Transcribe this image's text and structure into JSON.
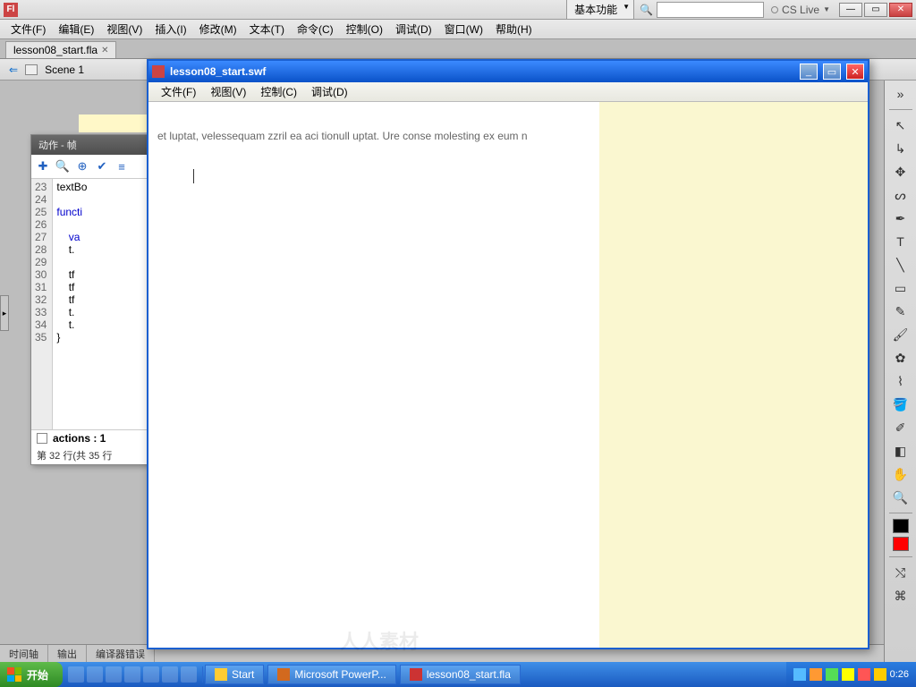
{
  "app": {
    "icon_label": "Fl"
  },
  "workspace": {
    "label": "基本功能"
  },
  "cslive": {
    "label": "CS Live"
  },
  "menu": [
    "文件(F)",
    "编辑(E)",
    "视图(V)",
    "插入(I)",
    "修改(M)",
    "文本(T)",
    "命令(C)",
    "控制(O)",
    "调试(D)",
    "窗口(W)",
    "帮助(H)"
  ],
  "doc_tab": {
    "label": "lesson08_start.fla",
    "close": "✕"
  },
  "scene": {
    "label": "Scene 1",
    "back": "⇐"
  },
  "actions": {
    "title": "动作 - 帧",
    "tools": [
      "✚",
      "🔍",
      "⊕",
      "✔",
      "≡"
    ],
    "lines": {
      "23": "textBo",
      "24": "",
      "25": "functi",
      "26": "",
      "27": "    va",
      "28": "    t.",
      "29": "",
      "30": "    tf",
      "31": "    tf",
      "32": "    tf",
      "33": "    t.",
      "34": "    t.",
      "35": "}"
    },
    "status": "actions : 1",
    "footer": "第 32 行(共 35 行"
  },
  "bottom_tabs": [
    "时间轴",
    "输出",
    "编译器错误"
  ],
  "swf": {
    "title": "lesson08_start.swf",
    "menu": [
      "文件(F)",
      "视图(V)",
      "控制(C)",
      "调试(D)"
    ],
    "body_text": "et luptat, velessequam zzril ea aci tionull uptat. Ure conse molesting ex eum n"
  },
  "tools": {
    "arrow": "↖",
    "subsel": "↳",
    "freet": "✥",
    "lasso": "ᔕ",
    "pen": "✒",
    "text": "T",
    "line": "╲",
    "rect": "▭",
    "pencil": "✎",
    "brush": "🖌",
    "deco": "✿",
    "bone": "⌇",
    "bucket": "🪣",
    "dropper": "✐",
    "eraser": "◧",
    "hand": "✋",
    "zoom": "🔍"
  },
  "taskbar": {
    "start": "开始",
    "tasks": [
      {
        "icon": "#ffcc33",
        "label": "Start"
      },
      {
        "icon": "#d2691e",
        "label": "Microsoft PowerP..."
      },
      {
        "icon": "#cc3333",
        "label": "lesson08_start.fla"
      }
    ],
    "clock": "0:26"
  },
  "watermark": "人人素材"
}
